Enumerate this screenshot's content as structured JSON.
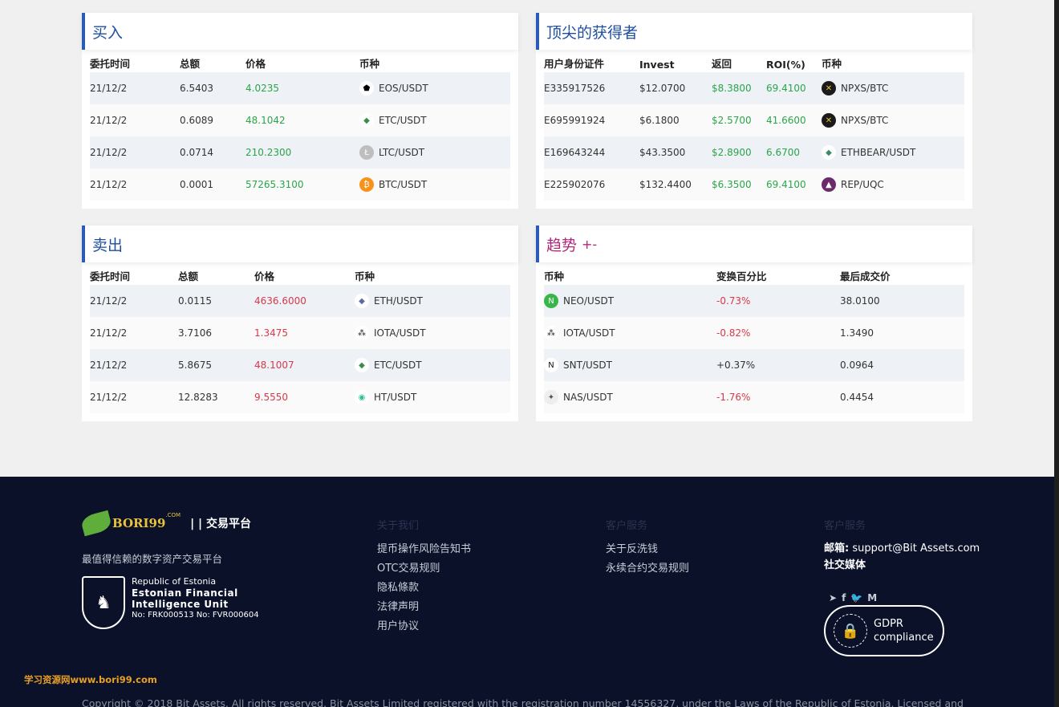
{
  "buy": {
    "title": "买入",
    "headers": [
      "委托时间",
      "总额",
      "价格",
      "币种"
    ],
    "rows": [
      {
        "time": "21/12/2",
        "amount": "6.5403",
        "price": "4.0235",
        "coin": "EOS/USDT",
        "icon": "eos-icon"
      },
      {
        "time": "21/12/2",
        "amount": "0.6089",
        "price": "48.1042",
        "coin": "ETC/USDT",
        "icon": "etc-icon"
      },
      {
        "time": "21/12/2",
        "amount": "0.0714",
        "price": "210.2300",
        "coin": "LTC/USDT",
        "icon": "ltc-icon"
      },
      {
        "time": "21/12/2",
        "amount": "0.0001",
        "price": "57265.3100",
        "coin": "BTC/USDT",
        "icon": "btc-icon"
      }
    ]
  },
  "top": {
    "title": "顶尖的获得者",
    "headers": [
      "用户身份证件",
      "Invest",
      "返回",
      "ROI(%)",
      "币种"
    ],
    "rows": [
      {
        "id": "E335917526",
        "invest": "$12.0700",
        "ret": "$8.3800",
        "roi": "69.4100",
        "coin": "NPXS/BTC",
        "icon": "npxs-icon"
      },
      {
        "id": "E695991924",
        "invest": "$6.1800",
        "ret": "$2.5700",
        "roi": "41.6600",
        "coin": "NPXS/BTC",
        "icon": "npxs-icon"
      },
      {
        "id": "E169643244",
        "invest": "$43.3500",
        "ret": "$2.8900",
        "roi": "6.6700",
        "coin": "ETHBEAR/USDT",
        "icon": "ethbear-icon"
      },
      {
        "id": "E225902076",
        "invest": "$132.4400",
        "ret": "$6.3500",
        "roi": "69.4100",
        "coin": "REP/UQC",
        "icon": "rep-icon"
      }
    ]
  },
  "sell": {
    "title": "卖出",
    "headers": [
      "委托时间",
      "总额",
      "价格",
      "币种"
    ],
    "rows": [
      {
        "time": "21/12/2",
        "amount": "0.0115",
        "price": "4636.6000",
        "coin": "ETH/USDT",
        "icon": "eth-icon"
      },
      {
        "time": "21/12/2",
        "amount": "3.7106",
        "price": "1.3475",
        "coin": "IOTA/USDT",
        "icon": "iota-icon"
      },
      {
        "time": "21/12/2",
        "amount": "5.8675",
        "price": "48.1007",
        "coin": "ETC/USDT",
        "icon": "etc-icon"
      },
      {
        "time": "21/12/2",
        "amount": "12.8283",
        "price": "9.5550",
        "coin": "HT/USDT",
        "icon": "ht-icon"
      }
    ]
  },
  "trend": {
    "title": "趋势",
    "suffix": "+-",
    "headers": [
      "币种",
      "变换百分比",
      "最后成交价"
    ],
    "rows": [
      {
        "coin": "NEO/USDT",
        "change": "-0.73%",
        "last": "38.0100",
        "icon": "neo-icon",
        "neg": true
      },
      {
        "coin": "IOTA/USDT",
        "change": "-0.82%",
        "last": "1.3490",
        "icon": "iota-icon",
        "neg": true
      },
      {
        "coin": "SNT/USDT",
        "change": "+0.37%",
        "last": "0.0964",
        "icon": "snt-icon",
        "neg": false
      },
      {
        "coin": "NAS/USDT",
        "change": "-1.76%",
        "last": "0.4454",
        "icon": "nas-icon",
        "neg": true
      }
    ]
  },
  "footer": {
    "brand": "BORI99",
    "brand_com": ".COM",
    "platform": "| | 交易平台",
    "slogan": "最值得信赖的数字资产交易平台",
    "estonia_line1": "Republic of Estonia",
    "estonia_line2": "Estonian Financial",
    "estonia_line3": "Intelligence Unit",
    "estonia_line4": "No: FRK000513 No: FVR000604",
    "col1_title": "关于我们",
    "col1_links": [
      "提币操作风险告知书",
      "OTC交易规则",
      "隐私條款",
      "法律声明",
      "用户协议"
    ],
    "col2_title": "客户服务",
    "col2_links": [
      "关于反洗钱",
      "永续合约交易规则"
    ],
    "col3_title": "客户服务",
    "email_label": "邮箱:",
    "email": "support@Bit Assets.com",
    "social_label": "社交媒体",
    "gdpr_line1": "GDPR",
    "gdpr_line2": "compliance",
    "watermark": "学习资源网www.bori99.com",
    "copyright": "Copyright © 2018 Bit Assets. All rights reserved. Bit Assets Limited registered with the registration number 14556327, under the Laws of the Republic of Estonia. Licensed and"
  }
}
